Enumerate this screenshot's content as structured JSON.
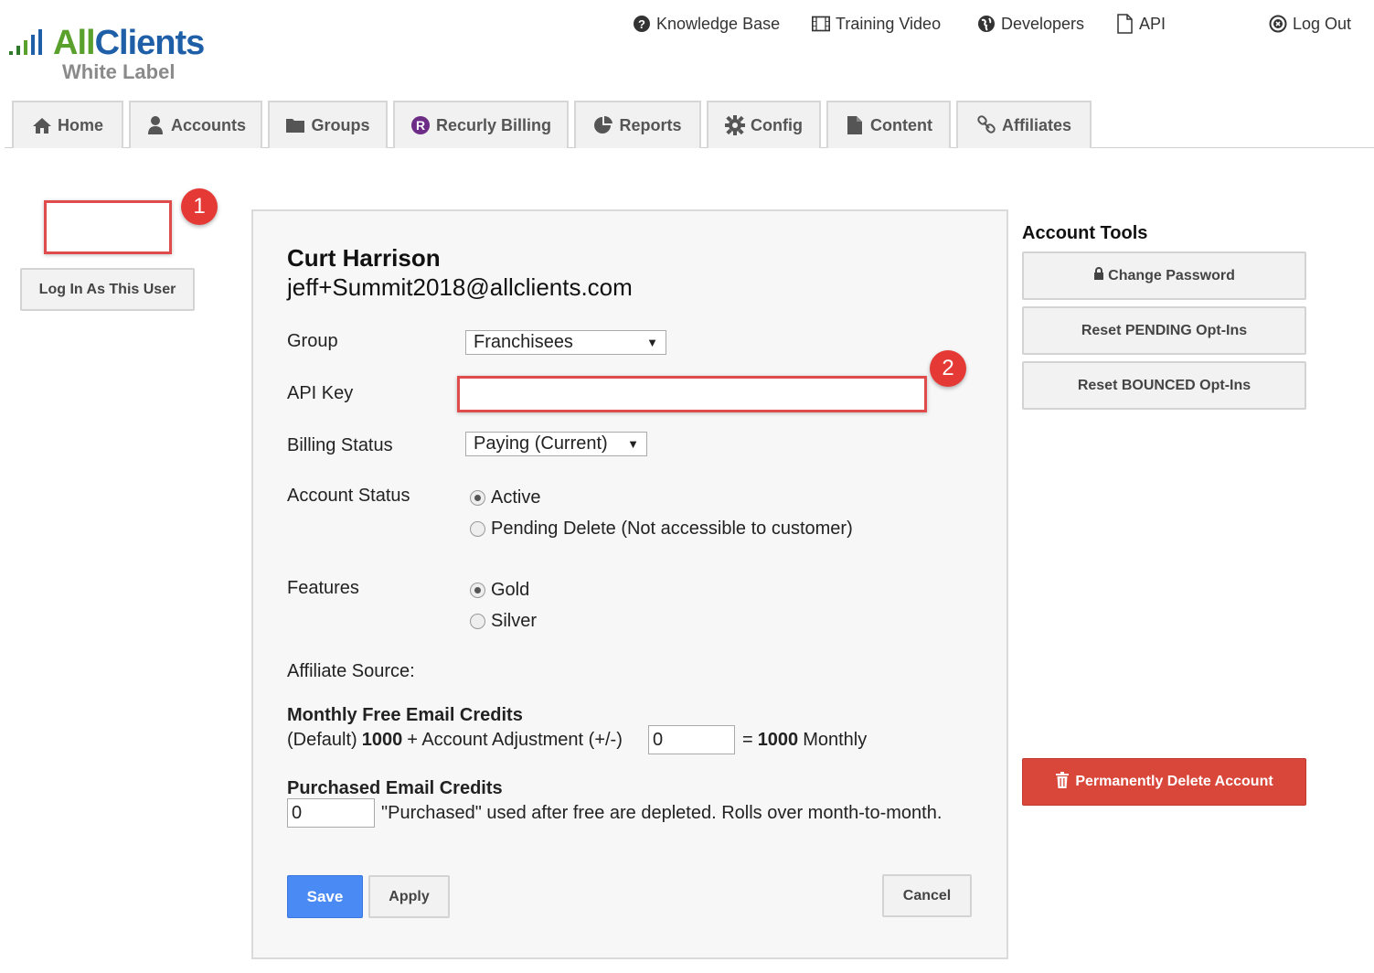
{
  "logo": {
    "brand_a": "All",
    "brand_b": "Clients",
    "subtitle": "White Label"
  },
  "top_links": {
    "knowledge_base": "Knowledge Base",
    "training_video": "Training Video",
    "developers": "Developers",
    "api": "API",
    "log_out": "Log Out"
  },
  "nav": {
    "home": "Home",
    "accounts": "Accounts",
    "groups": "Groups",
    "recurly_billing": "Recurly Billing",
    "reports": "Reports",
    "config": "Config",
    "content": "Content",
    "affiliates": "Affiliates"
  },
  "callouts": {
    "one": "1",
    "two": "2"
  },
  "left": {
    "login_as_user": "Log In As This User"
  },
  "account": {
    "name": "Curt Harrison",
    "email": "jeff+Summit2018@allclients.com",
    "group_label": "Group",
    "group_value": "Franchisees",
    "api_key_label": "API Key",
    "billing_label": "Billing Status",
    "billing_value": "Paying (Current)",
    "account_status_label": "Account Status",
    "status_active": "Active",
    "status_pending": "Pending Delete (Not accessible to customer)",
    "features_label": "Features",
    "feature_gold": "Gold",
    "feature_silver": "Silver",
    "affiliate_source_label": "Affiliate Source:",
    "monthly_title": "Monthly Free Email Credits",
    "monthly_default_label": "(Default)",
    "monthly_default_value": "1000",
    "monthly_adjust_label": "+ Account Adjustment (+/-)",
    "monthly_adjust_value": "0",
    "monthly_equals": "=",
    "monthly_total": "1000",
    "monthly_suffix": "Monthly",
    "purchased_title": "Purchased Email Credits",
    "purchased_value": "0",
    "purchased_note": "\"Purchased\" used after free are depleted. Rolls over month-to-month.",
    "save": "Save",
    "apply": "Apply",
    "cancel": "Cancel"
  },
  "tools": {
    "title": "Account Tools",
    "change_password": "Change Password",
    "reset_pending": "Reset PENDING Opt-Ins",
    "reset_bounced": "Reset BOUNCED Opt-Ins",
    "delete_account": "Permanently Delete Account"
  },
  "colors": {
    "brand_green": "#5aa02c",
    "brand_blue": "#1f5fa8",
    "callout_red": "#e53935",
    "save_blue": "#4a8af4",
    "delete_red": "#d9473a"
  }
}
